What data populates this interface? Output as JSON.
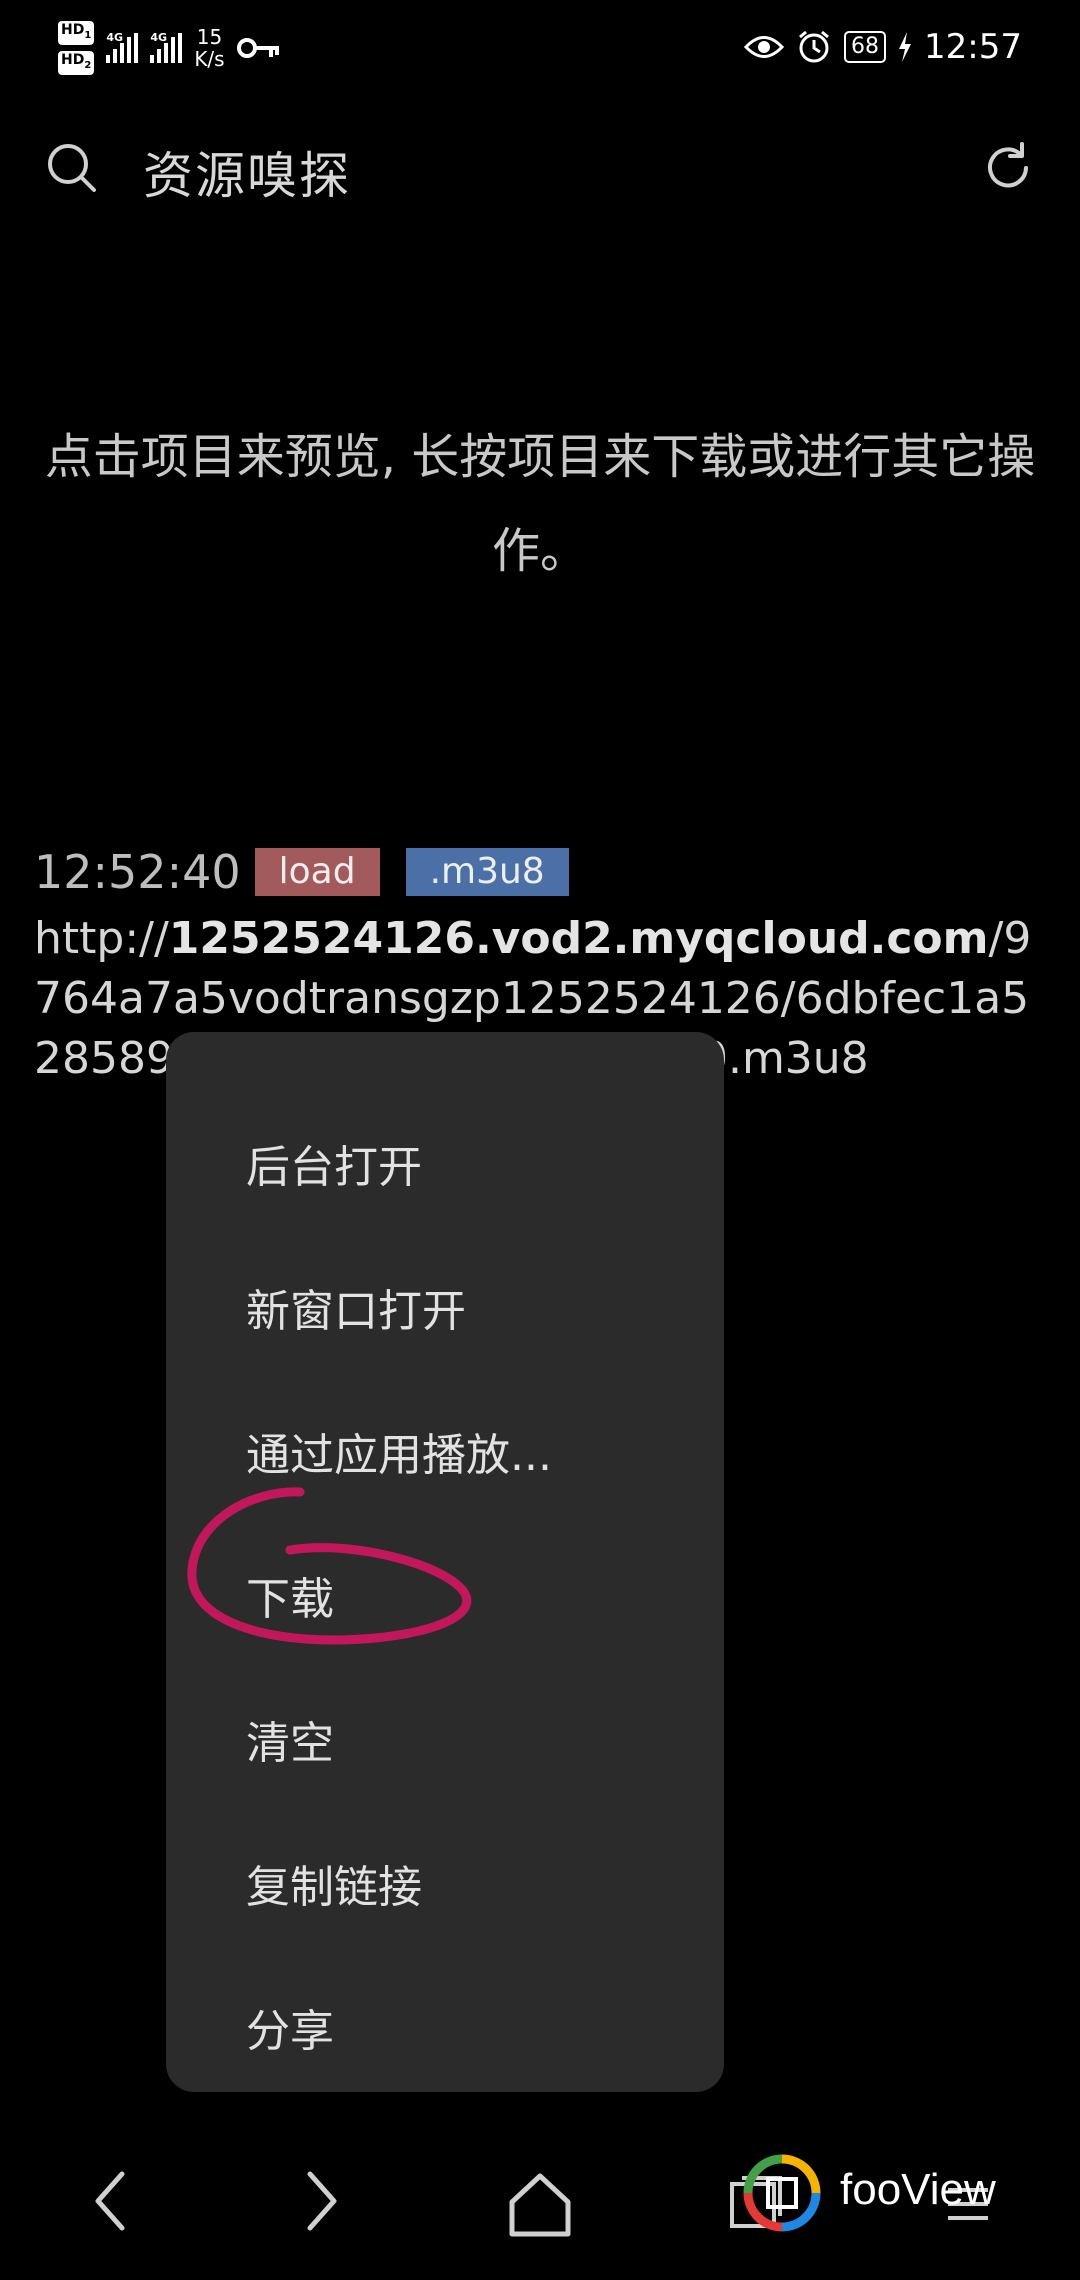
{
  "status_bar": {
    "hd1": "HD",
    "hd1_index": "1",
    "hd2": "HD",
    "hd2_index": "2",
    "network1": "4G",
    "network2": "4G",
    "speed_value": "15",
    "speed_unit": "K/s",
    "battery": "68",
    "time": "12:57"
  },
  "header": {
    "title": "资源嗅探"
  },
  "hint": "点击项目来预览, 长按项目来下载或进行其它操作。",
  "entry": {
    "time": "12:52:40",
    "badge_type": "load",
    "badge_ext": ".m3u8",
    "url_prefix": "http://",
    "url_host": "1252524126.vod2.myqcloud.com",
    "url_path": "/9764a7a5vodtransgzp1252524126/6dbfec1a5285890",
    "url_tail": "30.m3u8"
  },
  "menu": {
    "items": [
      "后台打开",
      "新窗口打开",
      "通过应用播放...",
      "下载",
      "清空",
      "复制链接",
      "分享"
    ]
  },
  "watermark": {
    "text": "fooView"
  },
  "colors": {
    "background": "#000000",
    "menu_background": "#2b2b2b",
    "badge_load": "#a35a5c",
    "badge_ext": "#4b70a7",
    "annotation": "#c2185b"
  }
}
